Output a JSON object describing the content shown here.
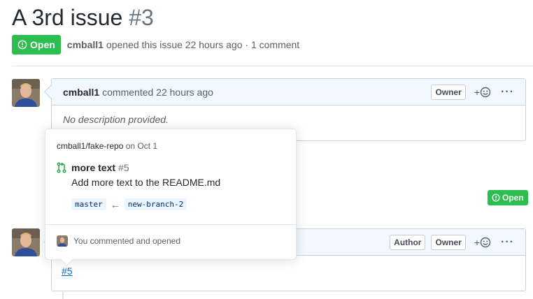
{
  "issue": {
    "title": "A 3rd issue",
    "number": "#3",
    "state": "Open",
    "author": "cmball1",
    "opened_text": "opened this issue 22 hours ago · 1 comment",
    "state_color": "#2cbe4e"
  },
  "comment1": {
    "author": "cmball1",
    "action": "commented 22 hours ago",
    "owner_label": "Owner",
    "reaction_label": "+",
    "body": "No description provided."
  },
  "timeline": {
    "pr_state": "Open"
  },
  "comment2": {
    "author_label": "Author",
    "owner_label": "Owner",
    "reaction_label": "+",
    "link": "#5"
  },
  "hovercard": {
    "repo": "cmball1/fake-repo",
    "repo_date": "on Oct 1",
    "pr_title": "more text",
    "pr_number": "#5",
    "pr_description": "Add more text to the README.md",
    "base_branch": "master",
    "head_branch": "new-branch-2",
    "footer": "You commented and opened"
  },
  "icons": {
    "state": "issue-opened-icon",
    "pr": "git-pull-request-icon",
    "reaction": "smiley-icon",
    "more": "kebab-horizontal-icon",
    "arrow": "left-arrow-icon"
  }
}
